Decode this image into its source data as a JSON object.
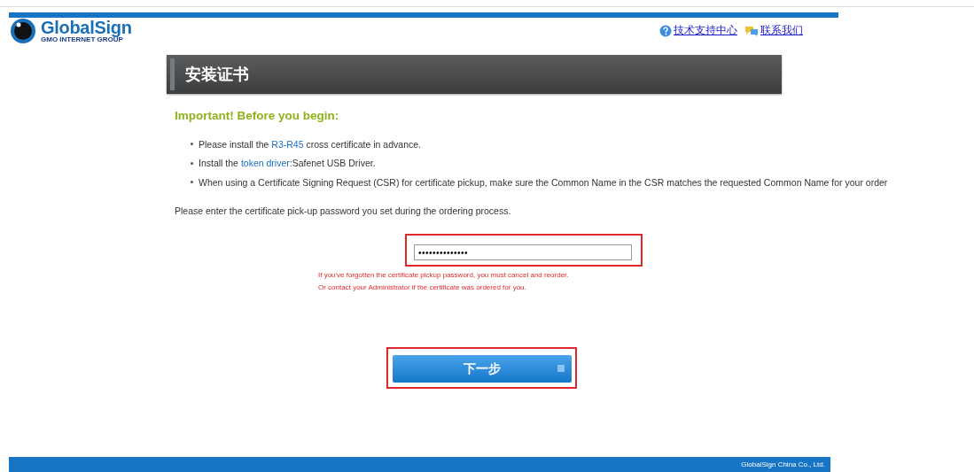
{
  "header": {
    "logo": {
      "name": "GlobalSign",
      "tagline": "GMO INTERNET GROUP"
    },
    "links": [
      {
        "kind": "help",
        "label": "技术支持中心"
      },
      {
        "kind": "chat",
        "label": "联系我们"
      }
    ]
  },
  "page_title": "安装证书",
  "notice": {
    "heading": "Important! Before you begin:",
    "items": [
      {
        "before": "Please install the ",
        "link": "R3-R45",
        "after": " cross certificate in advance."
      },
      {
        "before": "Install the ",
        "link": "token driver",
        "after": ":Safenet USB Driver."
      },
      {
        "before": "When using a Certificate Signing Request (CSR) for certificate pickup, make sure the Common Name in the CSR matches the requested Common Name for your order"
      }
    ]
  },
  "instruction": "Please enter the certificate pick-up password you set during the ordering process.",
  "password": {
    "value": "••••••••••••••",
    "highlighted": true
  },
  "errors": [
    "If you've forgotten the certificate pickup password, you must cancel and reorder.",
    "Or contact your Administrator if the certificate was ordered for you."
  ],
  "next_button": {
    "label": "下一步",
    "highlighted": true
  },
  "footer": "GlobalSign China Co., Ltd."
}
